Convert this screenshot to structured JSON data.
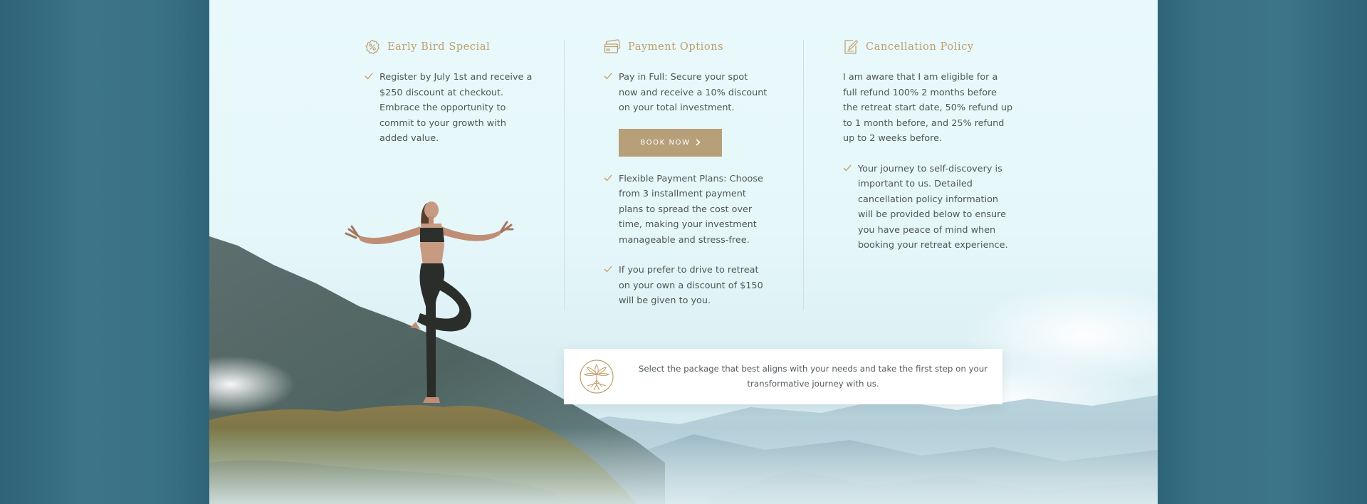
{
  "early_bird": {
    "title": "Early Bird Special",
    "icon": "percent-badge-icon",
    "items": [
      {
        "text": "Register by July 1st and receive a $250 discount at checkout. Embrace the opportunity to commit to your growth with added value."
      }
    ]
  },
  "payment": {
    "title": "Payment Options",
    "icon": "credit-card-icon",
    "items": [
      {
        "text": "Pay in Full: Secure your spot now and receive a 10% discount on your total investment."
      },
      {
        "text": "Flexible Payment Plans: Choose from 3 installment payment plans to spread the cost over time, making your investment manageable and stress-free."
      },
      {
        "text": "If you prefer to drive to retreat on your own a discount of $150 will be given to you."
      }
    ],
    "book_button": "BOOK NOW"
  },
  "cancellation": {
    "title": "Cancellation Policy",
    "icon": "edit-document-icon",
    "intro": "I am aware that I am eligible for a full refund 100% 2 months before the retreat start date, 50% refund up to 1 month before, and 25% refund up to 2 weeks before.",
    "items": [
      {
        "text": "Your journey to self-discovery is important to us. Detailed cancellation policy information will be provided below to ensure you have peace of mind when booking your retreat experience."
      }
    ]
  },
  "info_card": {
    "logo": "lotus-tree-logo-icon",
    "text": "Select the package that best aligns with your needs and take the first step on your transformative journey with us."
  },
  "colors": {
    "accent_gold": "#bf9f6e",
    "button_bg": "#b79f79",
    "body_text": "#4e5659",
    "page_outer": "#2f6478"
  }
}
